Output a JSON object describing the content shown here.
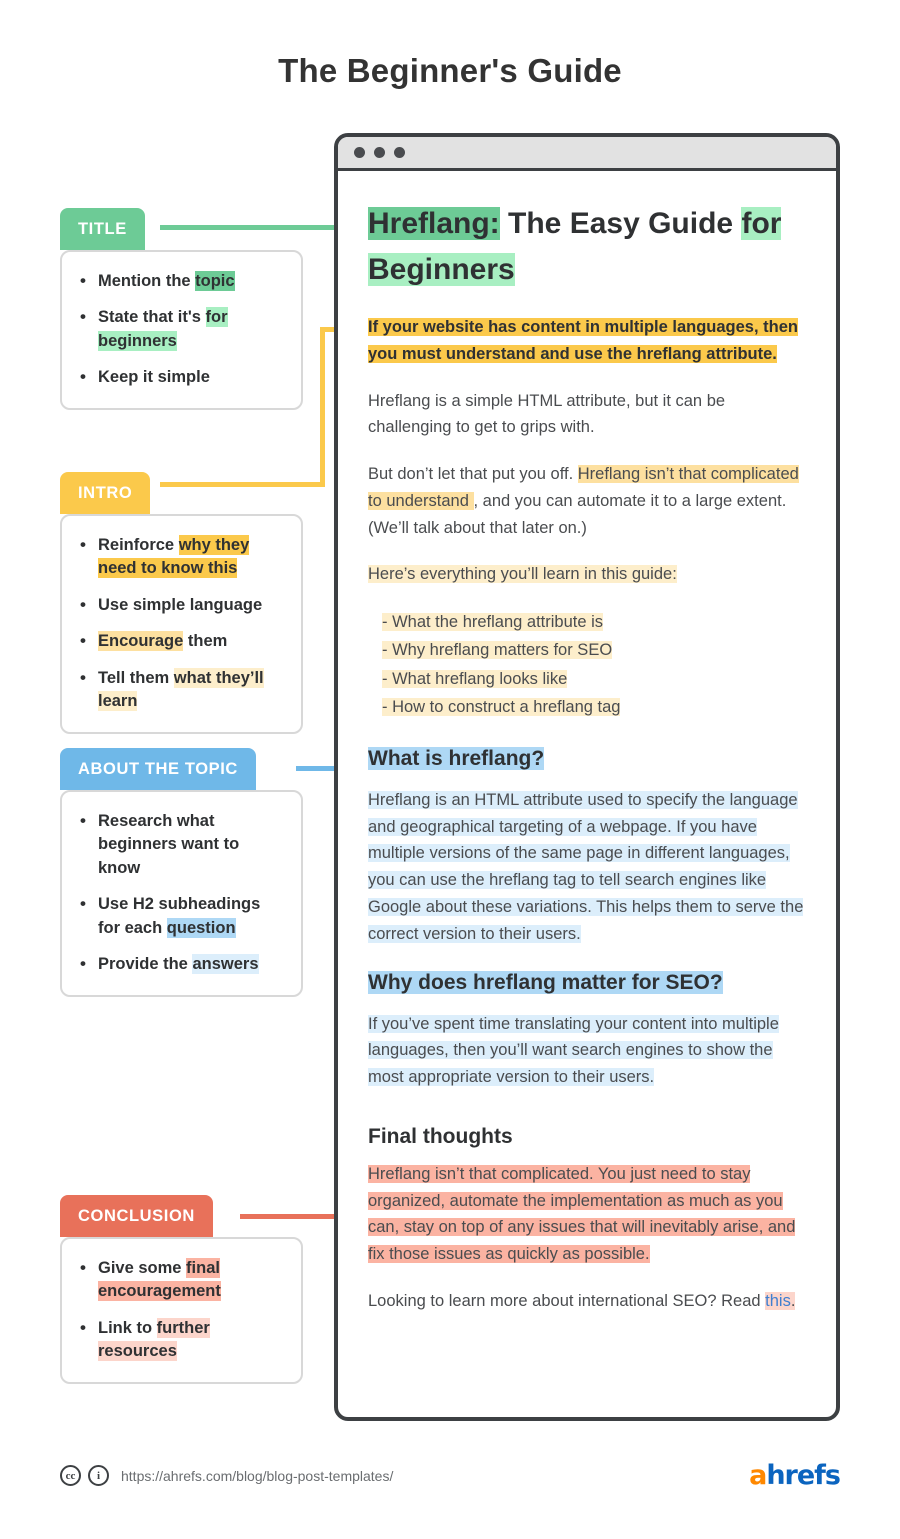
{
  "page_title": "The Beginner's Guide",
  "colors": {
    "green": "#6dcb96",
    "green_light": "#a8efc2",
    "yellow": "#fbc94b",
    "yellow_mid": "#fde0a0",
    "yellow_light": "#fdeecb",
    "blue": "#6fb8e8",
    "blue_mid": "#aed8f5",
    "blue_light": "#dceefb",
    "coral": "#e8715a",
    "pink_mid": "#fbb3a2",
    "pink_light": "#fcd5cb",
    "frame": "#3d4043"
  },
  "browser": {
    "dots": [
      "dot-1",
      "dot-2",
      "dot-3"
    ],
    "headline": {
      "part_highlighted": "Hreflang:",
      "part_plain": " The Easy Guide",
      "part_highlighted_light": "for Beginners"
    },
    "lead": "If your website has content in multiple languages, then you must understand and use the hreflang attribute.",
    "paragraph_1": "Hreflang is a simple HTML attribute, but it can be challenging to get to grips with.",
    "paragraph_2": {
      "before": "But don’t let that put you off. ",
      "highlight": " Hreflang isn’t that complicated to understand ",
      "after": ", and you can automate it to a large extent. (We’ll talk about that later on.)"
    },
    "lead_in": "Here’s everything you’ll learn in this guide:",
    "toc": [
      "- What the hreflang attribute is",
      "- Why hreflang matters for SEO",
      "- What hreflang looks like",
      "- How to construct a hreflang tag"
    ],
    "h2_one": "What is hreflang?",
    "section_one": "Hreflang is an HTML attribute used to specify the language and geographical targeting of a webpage. If you have multiple versions of the same page in different languages, you can use the hreflang tag to tell search engines like Google about these variations. This helps them to serve the correct version to their users.",
    "h2_two": "Why does hreflang matter for SEO?",
    "section_two": "If you’ve spent time translating your content into multiple languages, then you’ll want search engines to show the most appropriate version to their users.",
    "h2_three": "Final thoughts",
    "conclusion": "Hreflang isn’t that complicated. You just need to stay organized, automate the implementation as much as you can, stay on top of any issues that will inevitably arise, and fix those issues as quickly as possible.",
    "outro": {
      "before": "Looking to learn more about international SEO? Read ",
      "link": "this",
      "after": "."
    }
  },
  "annotations": [
    {
      "tag": "TITLE",
      "items": [
        {
          "plain": "Mention the ",
          "mark": "topic",
          "tail": "",
          "shade": "strong"
        },
        {
          "plain": "State that it's ",
          "mark": "for beginners",
          "tail": "",
          "shade": "light"
        },
        {
          "plain": "Keep it simple",
          "mark": "",
          "tail": "",
          "shade": "none"
        }
      ]
    },
    {
      "tag": "INTRO",
      "items": [
        {
          "plain": "Reinforce ",
          "mark": "why they need to know this",
          "tail": "",
          "shade": "strong"
        },
        {
          "plain": "Use simple language",
          "mark": "",
          "tail": "",
          "shade": "none"
        },
        {
          "plain": "",
          "mark": "Encourage",
          "tail": " them",
          "shade": "mid"
        },
        {
          "plain": "Tell them ",
          "mark": "what they’ll learn",
          "tail": "",
          "shade": "light"
        }
      ]
    },
    {
      "tag": "ABOUT THE TOPIC",
      "items": [
        {
          "plain": "Research what beginners want to know",
          "mark": "",
          "tail": "",
          "shade": "none"
        },
        {
          "plain": "Use H2 subheadings for each ",
          "mark": "question",
          "tail": "",
          "shade": "strong"
        },
        {
          "plain": "Provide the ",
          "mark": "answers",
          "tail": "",
          "shade": "light"
        }
      ]
    },
    {
      "tag": "CONCLUSION",
      "items": [
        {
          "plain": "Give some ",
          "mark": "final encouragement",
          "tail": "",
          "shade": "strong"
        },
        {
          "plain": "Link to ",
          "mark": "further resources",
          "tail": "",
          "shade": "light"
        }
      ]
    }
  ],
  "footer": {
    "cc_icon": "cc",
    "by_icon": "i",
    "url": "https://ahrefs.com/blog/blog-post-templates/",
    "logo_a": "a",
    "logo_rest": "hrefs"
  }
}
